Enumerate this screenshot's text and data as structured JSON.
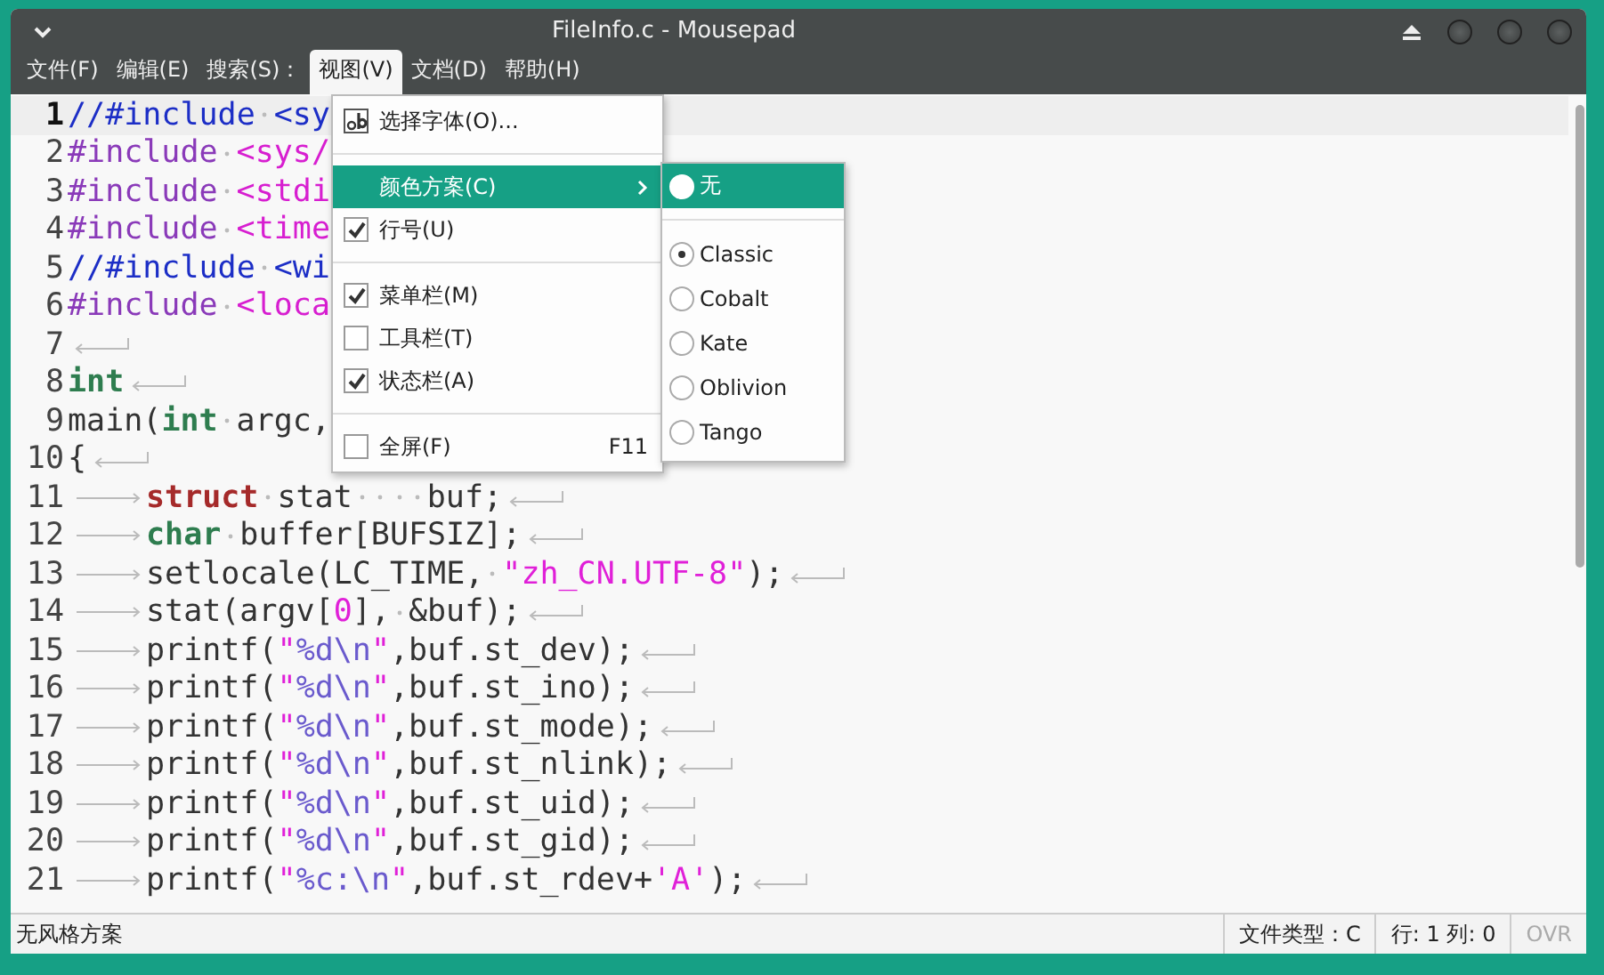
{
  "window": {
    "title": "FileInfo.c - Mousepad"
  },
  "menubar": [
    {
      "label": "文件(F)",
      "selected": false
    },
    {
      "label": "编辑(E)",
      "selected": false
    },
    {
      "label": "搜索(S)：",
      "selected": false
    },
    {
      "label": "视图(V)",
      "selected": true
    },
    {
      "label": "文档(D)",
      "selected": false
    },
    {
      "label": "帮助(H)",
      "selected": false
    }
  ],
  "editor": {
    "lines": [
      {
        "number": "1",
        "current": true,
        "tokens": [
          {
            "kind": "comment",
            "text": "//#include"
          },
          {
            "kind": "space"
          },
          {
            "kind": "comment",
            "text": "<sy"
          }
        ]
      },
      {
        "number": "2",
        "current": false,
        "tokens": [
          {
            "kind": "preproc",
            "text": "#include"
          },
          {
            "kind": "space"
          },
          {
            "kind": "path",
            "text": "<sys/"
          }
        ]
      },
      {
        "number": "3",
        "current": false,
        "tokens": [
          {
            "kind": "preproc",
            "text": "#include"
          },
          {
            "kind": "space"
          },
          {
            "kind": "path",
            "text": "<stdi"
          }
        ]
      },
      {
        "number": "4",
        "current": false,
        "tokens": [
          {
            "kind": "preproc",
            "text": "#include"
          },
          {
            "kind": "space"
          },
          {
            "kind": "path",
            "text": "<time"
          }
        ]
      },
      {
        "number": "5",
        "current": false,
        "tokens": [
          {
            "kind": "comment",
            "text": "//#include"
          },
          {
            "kind": "space"
          },
          {
            "kind": "comment",
            "text": "<wi"
          }
        ]
      },
      {
        "number": "6",
        "current": false,
        "tokens": [
          {
            "kind": "preproc",
            "text": "#include"
          },
          {
            "kind": "space"
          },
          {
            "kind": "path",
            "text": "<loca"
          }
        ]
      },
      {
        "number": "7",
        "current": false,
        "tokens": [
          {
            "kind": "eol"
          }
        ]
      },
      {
        "number": "8",
        "current": false,
        "tokens": [
          {
            "kind": "type",
            "text": "int"
          },
          {
            "kind": "eol"
          }
        ]
      },
      {
        "number": "9",
        "current": false,
        "tokens": [
          {
            "kind": "plain",
            "text": "main("
          },
          {
            "kind": "type",
            "text": "int"
          },
          {
            "kind": "space"
          },
          {
            "kind": "plain",
            "text": "argc,"
          }
        ]
      },
      {
        "number": "10",
        "current": false,
        "tokens": [
          {
            "kind": "plain",
            "text": "{"
          },
          {
            "kind": "eol"
          }
        ]
      },
      {
        "number": "11",
        "current": false,
        "tokens": [
          {
            "kind": "tab"
          },
          {
            "kind": "keyword",
            "text": "struct"
          },
          {
            "kind": "space"
          },
          {
            "kind": "plain",
            "text": "stat"
          },
          {
            "kind": "space"
          },
          {
            "kind": "space"
          },
          {
            "kind": "space"
          },
          {
            "kind": "space"
          },
          {
            "kind": "plain",
            "text": "buf;"
          },
          {
            "kind": "eol"
          }
        ]
      },
      {
        "number": "12",
        "current": false,
        "tokens": [
          {
            "kind": "tab"
          },
          {
            "kind": "type",
            "text": "char"
          },
          {
            "kind": "space"
          },
          {
            "kind": "plain",
            "text": "buffer[BUFSIZ];"
          },
          {
            "kind": "eol"
          }
        ]
      },
      {
        "number": "13",
        "current": false,
        "tokens": [
          {
            "kind": "tab"
          },
          {
            "kind": "plain",
            "text": "setlocale(LC_TIME,"
          },
          {
            "kind": "space"
          },
          {
            "kind": "string",
            "text": "\"zh_CN.UTF-8\""
          },
          {
            "kind": "plain",
            "text": ");"
          },
          {
            "kind": "eol"
          }
        ]
      },
      {
        "number": "14",
        "current": false,
        "tokens": [
          {
            "kind": "tab"
          },
          {
            "kind": "plain",
            "text": "stat(argv["
          },
          {
            "kind": "number",
            "text": "0"
          },
          {
            "kind": "plain",
            "text": "],"
          },
          {
            "kind": "space"
          },
          {
            "kind": "plain",
            "text": "&buf);"
          },
          {
            "kind": "eol"
          }
        ]
      },
      {
        "number": "15",
        "current": false,
        "tokens": [
          {
            "kind": "tab"
          },
          {
            "kind": "plain",
            "text": "printf("
          },
          {
            "kind": "string",
            "text": "\""
          },
          {
            "kind": "escape",
            "text": "%d\\n"
          },
          {
            "kind": "string",
            "text": "\""
          },
          {
            "kind": "plain",
            "text": ",buf.st_dev);"
          },
          {
            "kind": "eol"
          }
        ]
      },
      {
        "number": "16",
        "current": false,
        "tokens": [
          {
            "kind": "tab"
          },
          {
            "kind": "plain",
            "text": "printf("
          },
          {
            "kind": "string",
            "text": "\""
          },
          {
            "kind": "escape",
            "text": "%d\\n"
          },
          {
            "kind": "string",
            "text": "\""
          },
          {
            "kind": "plain",
            "text": ",buf.st_ino);"
          },
          {
            "kind": "eol"
          }
        ]
      },
      {
        "number": "17",
        "current": false,
        "tokens": [
          {
            "kind": "tab"
          },
          {
            "kind": "plain",
            "text": "printf("
          },
          {
            "kind": "string",
            "text": "\""
          },
          {
            "kind": "escape",
            "text": "%d\\n"
          },
          {
            "kind": "string",
            "text": "\""
          },
          {
            "kind": "plain",
            "text": ",buf.st_mode);"
          },
          {
            "kind": "eol"
          }
        ]
      },
      {
        "number": "18",
        "current": false,
        "tokens": [
          {
            "kind": "tab"
          },
          {
            "kind": "plain",
            "text": "printf("
          },
          {
            "kind": "string",
            "text": "\""
          },
          {
            "kind": "escape",
            "text": "%d\\n"
          },
          {
            "kind": "string",
            "text": "\""
          },
          {
            "kind": "plain",
            "text": ",buf.st_nlink);"
          },
          {
            "kind": "eol"
          }
        ]
      },
      {
        "number": "19",
        "current": false,
        "tokens": [
          {
            "kind": "tab"
          },
          {
            "kind": "plain",
            "text": "printf("
          },
          {
            "kind": "string",
            "text": "\""
          },
          {
            "kind": "escape",
            "text": "%d\\n"
          },
          {
            "kind": "string",
            "text": "\""
          },
          {
            "kind": "plain",
            "text": ",buf.st_uid);"
          },
          {
            "kind": "eol"
          }
        ]
      },
      {
        "number": "20",
        "current": false,
        "tokens": [
          {
            "kind": "tab"
          },
          {
            "kind": "plain",
            "text": "printf("
          },
          {
            "kind": "string",
            "text": "\""
          },
          {
            "kind": "escape",
            "text": "%d\\n"
          },
          {
            "kind": "string",
            "text": "\""
          },
          {
            "kind": "plain",
            "text": ",buf.st_gid);"
          },
          {
            "kind": "eol"
          }
        ]
      },
      {
        "number": "21",
        "current": false,
        "tokens": [
          {
            "kind": "tab"
          },
          {
            "kind": "plain",
            "text": "printf("
          },
          {
            "kind": "string",
            "text": "\""
          },
          {
            "kind": "escape",
            "text": "%c:\\n"
          },
          {
            "kind": "string",
            "text": "\""
          },
          {
            "kind": "plain",
            "text": ",buf.st_rdev+"
          },
          {
            "kind": "string",
            "text": "'A'"
          },
          {
            "kind": "plain",
            "text": ");"
          },
          {
            "kind": "eol"
          }
        ]
      }
    ]
  },
  "view_menu": [
    {
      "kind": "command",
      "label": "选择字体(O)...",
      "highlighted": false
    },
    {
      "kind": "separator"
    },
    {
      "kind": "submenu",
      "label": "颜色方案(C)",
      "highlighted": true
    },
    {
      "kind": "check",
      "label": "行号(U)",
      "checked": true,
      "highlighted": false
    },
    {
      "kind": "separator"
    },
    {
      "kind": "check",
      "label": "菜单栏(M)",
      "checked": true,
      "highlighted": false
    },
    {
      "kind": "check",
      "label": "工具栏(T)",
      "checked": false,
      "highlighted": false
    },
    {
      "kind": "check",
      "label": "状态栏(A)",
      "checked": true,
      "highlighted": false
    },
    {
      "kind": "separator"
    },
    {
      "kind": "check",
      "label": "全屏(F)",
      "checked": false,
      "highlighted": false,
      "shortcut": "F11"
    }
  ],
  "color_scheme_menu": [
    {
      "kind": "radio",
      "label": "无",
      "selected": false,
      "highlighted": true
    },
    {
      "kind": "separator"
    },
    {
      "kind": "radio",
      "label": "Classic",
      "selected": true,
      "highlighted": false
    },
    {
      "kind": "radio",
      "label": "Cobalt",
      "selected": false,
      "highlighted": false
    },
    {
      "kind": "radio",
      "label": "Kate",
      "selected": false,
      "highlighted": false
    },
    {
      "kind": "radio",
      "label": "Oblivion",
      "selected": false,
      "highlighted": false
    },
    {
      "kind": "radio",
      "label": "Tango",
      "selected": false,
      "highlighted": false
    }
  ],
  "status_bar": {
    "message": "无风格方案",
    "filetype": "文件类型：C",
    "position": "行: 1 列: 0",
    "overwrite": {
      "label": "OVR",
      "disabled": true
    }
  }
}
